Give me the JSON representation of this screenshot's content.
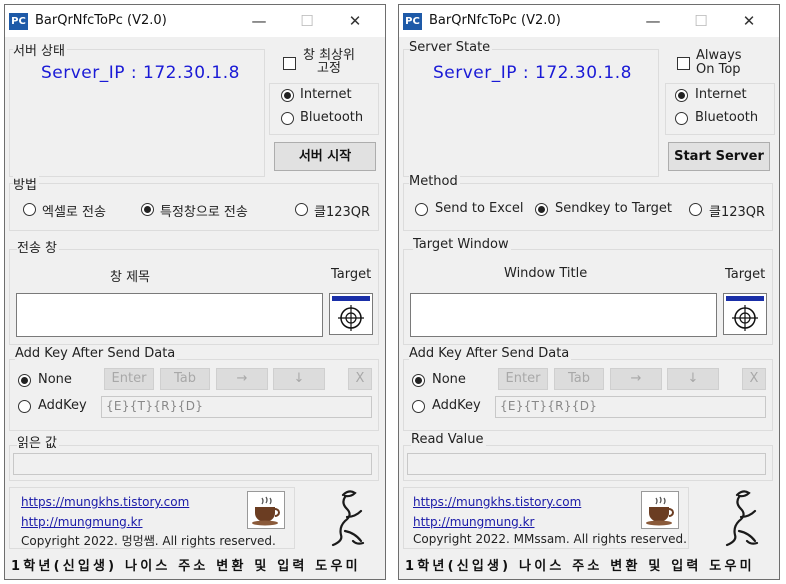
{
  "windows": [
    {
      "title": "BarQrNfcToPc (V2.0)",
      "app_icon_text": "PC",
      "controls": {
        "minimize": "—",
        "maximize": "☐",
        "close": "✕"
      },
      "server_state_label": "서버 상태",
      "server_ip_text": "Server_IP : 172.30.1.8",
      "always_on_top_label": "창 최상위\n고정",
      "always_on_top_checked": false,
      "conn": {
        "internet": "Internet",
        "bluetooth": "Bluetooth",
        "selected": "internet"
      },
      "start_button_label": "서버 시작",
      "method_label": "방법",
      "method_options": [
        "엑셀로 전송",
        "특정창으로 전송",
        "클123QR"
      ],
      "method_selected_index": 1,
      "target_window_label": "전송 창",
      "window_title_label": "창 제목",
      "target_label": "Target",
      "target_window_value": "",
      "add_key_label": "Add Key After Send Data",
      "none_label": "None",
      "addkey_label": "AddKey",
      "add_key_selected": "none",
      "key_buttons": [
        "Enter",
        "Tab",
        "→",
        "↓",
        "X"
      ],
      "addkey_field_value": "{E}{T}{R}{D}",
      "read_value_label": "읽은 값",
      "read_value": "",
      "link1": "https://mungkhs.tistory.com",
      "link2": "http://mungmung.kr",
      "copyright": "Copyright 2022. 멍멍쌤. All rights reserved.",
      "footer": "1학년(신입생) 나이스 주소 변환 및 입력 도우미"
    },
    {
      "title": "BarQrNfcToPc (V2.0)",
      "app_icon_text": "PC",
      "controls": {
        "minimize": "—",
        "maximize": "☐",
        "close": "✕"
      },
      "server_state_label": "Server State",
      "server_ip_text": "Server_IP : 172.30.1.8",
      "always_on_top_label": "Always\nOn Top",
      "always_on_top_checked": false,
      "conn": {
        "internet": "Internet",
        "bluetooth": "Bluetooth",
        "selected": "internet"
      },
      "start_button_label": "Start Server",
      "method_label": "Method",
      "method_options": [
        "Send to Excel",
        "Sendkey to Target",
        "클123QR"
      ],
      "method_selected_index": 1,
      "target_window_label": "Target Window",
      "window_title_label": "Window Title",
      "target_label": "Target",
      "target_window_value": "",
      "add_key_label": "Add Key After Send Data",
      "none_label": "None",
      "addkey_label": "AddKey",
      "add_key_selected": "none",
      "key_buttons": [
        "Enter",
        "Tab",
        "→",
        "↓",
        "X"
      ],
      "addkey_field_value": "{E}{T}{R}{D}",
      "read_value_label": "Read Value",
      "read_value": "",
      "link1": "https://mungkhs.tistory.com",
      "link2": "http://mungmung.kr",
      "copyright": "Copyright 2022. MMssam. All rights reserved.",
      "footer": "1학년(신입생) 나이스 주소 변환 및 입력 도우미"
    }
  ]
}
